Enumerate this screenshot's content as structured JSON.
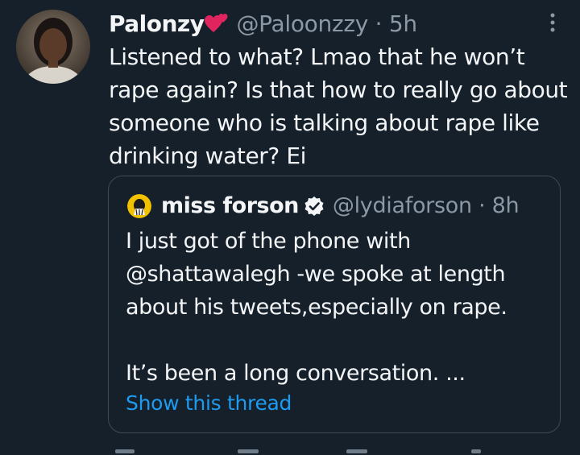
{
  "tweet": {
    "display_name": "Palonzy",
    "name_emoji": "two-hearts-emoji",
    "handle": "@Paloonzzy",
    "separator": "·",
    "time": "5h",
    "text_lines": [
      "Listened to what? Lmao that he won’t",
      "rape again? Is that how to really go about",
      "someone who is talking about rape like",
      "drinking water? Ei"
    ],
    "more_icon": "more-vertical-icon",
    "avatar": "user-avatar"
  },
  "quoted_tweet": {
    "display_name": "miss forson",
    "verified_icon": "verified-badge-icon",
    "handle": "@lydiaforson",
    "separator": "·",
    "time": "8h",
    "text_lines": [
      "I just got of the phone with",
      "@shattawalegh -we spoke at length",
      "about his tweets,especially on rape."
    ],
    "text_continued": "It’s been a long conversation. ...",
    "show_thread": "Show this thread"
  },
  "colors": {
    "background": "#15202b",
    "text": "#f3f5f7",
    "secondary_text": "#8b98a5",
    "link": "#1d9bf0",
    "border": "#3d4a57",
    "heart": "#e0245e"
  }
}
